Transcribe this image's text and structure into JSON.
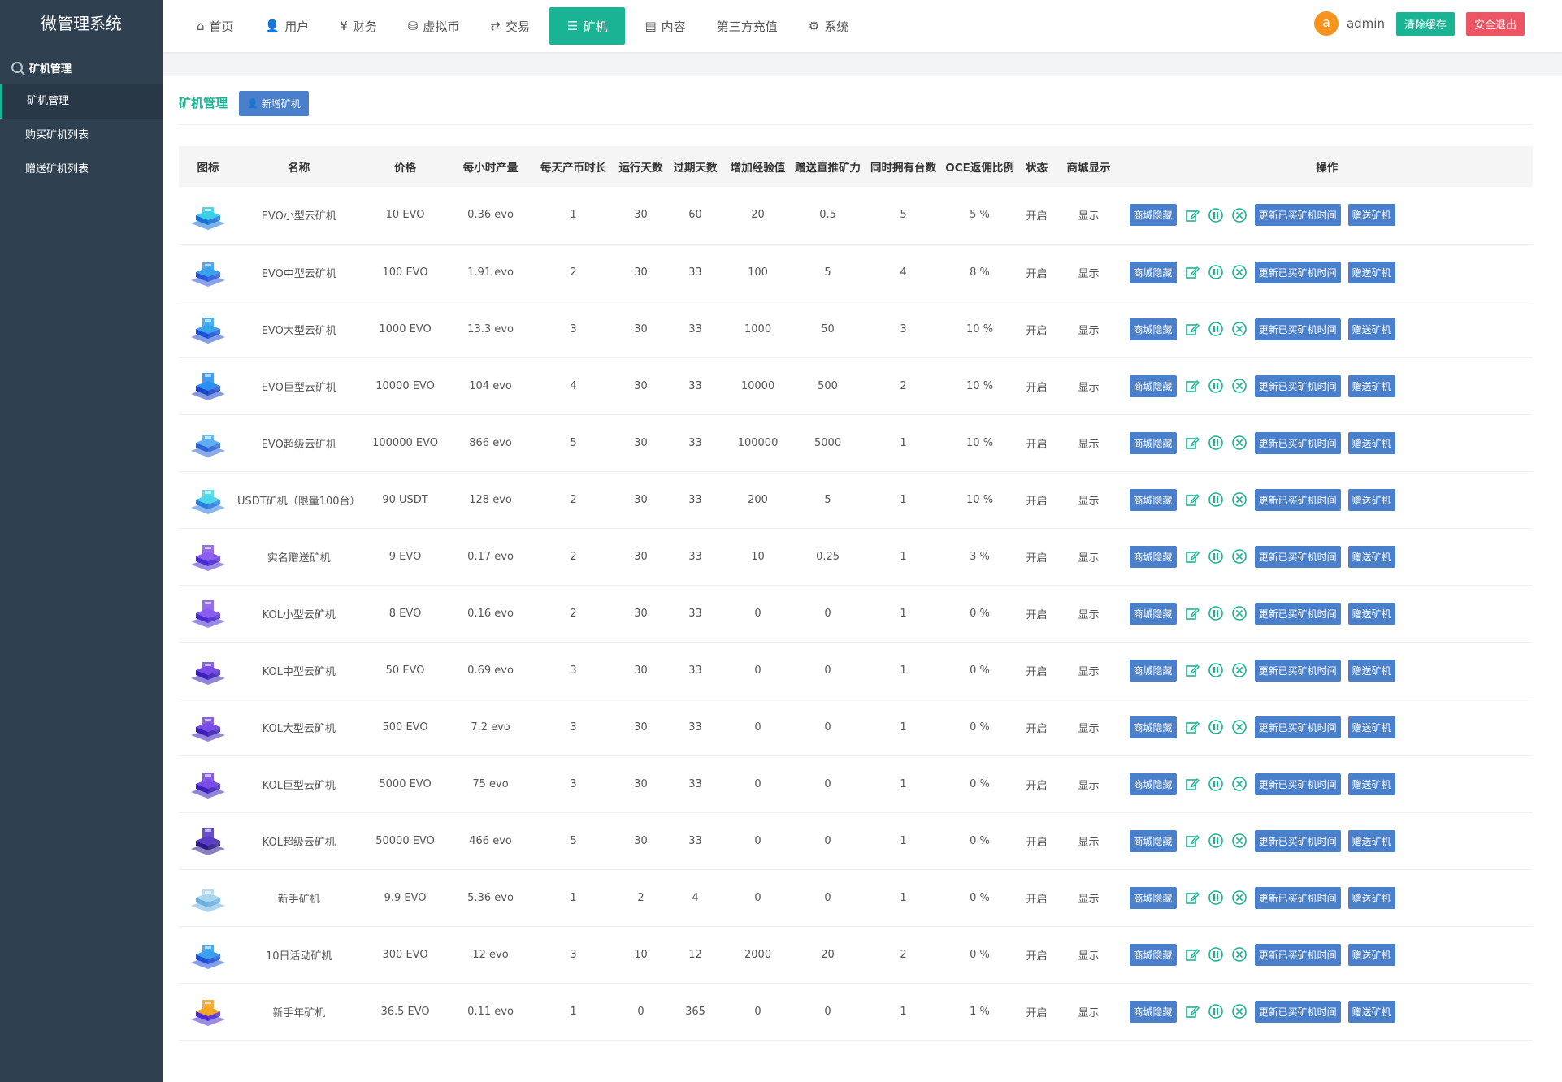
{
  "brand": "微管理系统",
  "sidebar": {
    "group": "矿机管理",
    "items": [
      {
        "label": "矿机管理",
        "active": true
      },
      {
        "label": "购买矿机列表",
        "active": false
      },
      {
        "label": "赠送矿机列表",
        "active": false
      }
    ]
  },
  "nav": [
    {
      "label": "首页",
      "icon": "home-icon",
      "glyph": "⌂"
    },
    {
      "label": "用户",
      "icon": "user-icon",
      "glyph": "👤"
    },
    {
      "label": "财务",
      "icon": "finance-icon",
      "glyph": "¥"
    },
    {
      "label": "虚拟币",
      "icon": "coin-icon",
      "glyph": "⛁"
    },
    {
      "label": "交易",
      "icon": "exchange-icon",
      "glyph": "⇄"
    },
    {
      "label": "矿机",
      "icon": "server-icon",
      "glyph": "☰"
    },
    {
      "label": "内容",
      "icon": "content-icon",
      "glyph": "▤"
    },
    {
      "label": "第三方充值",
      "icon": "",
      "glyph": ""
    },
    {
      "label": "系统",
      "icon": "gear-icon",
      "glyph": "⚙"
    }
  ],
  "user": {
    "avatar_letter": "a",
    "name": "admin"
  },
  "top_buttons": {
    "clear_cache": "清除缓存",
    "logout": "安全退出"
  },
  "panel": {
    "title": "矿机管理",
    "add_button": "新增矿机"
  },
  "colors": {
    "accent": "#1ab394",
    "blue": "#4a7fcc",
    "danger": "#ed5565",
    "sidebar": "#2f4050",
    "avatar": "#f7931e"
  },
  "table": {
    "headers": [
      "图标",
      "名称",
      "价格",
      "每小时产量",
      "每天产币时长",
      "运行天数",
      "过期天数",
      "增加经验值",
      "赠送直推矿力",
      "同时拥有台数",
      "OCE返佣比例",
      "状态",
      "商城显示",
      "操作"
    ],
    "actions": {
      "hide": "商城隐藏",
      "update_time": "更新已买矿机时间",
      "gift": "赠送矿机"
    },
    "rows": [
      {
        "icon": "evo-small-miner-icon",
        "name": "EVO小型云矿机",
        "price": "10 EVO",
        "hourly": "0.36 evo",
        "daily_hours": "1",
        "run_days": "30",
        "expire_days": "60",
        "exp": "20",
        "gift_power": "0.5",
        "max_own": "5",
        "ratio": "5 %",
        "status": "开启",
        "shop": "显示"
      },
      {
        "icon": "evo-medium-miner-icon",
        "name": "EVO中型云矿机",
        "price": "100 EVO",
        "hourly": "1.91 evo",
        "daily_hours": "2",
        "run_days": "30",
        "expire_days": "33",
        "exp": "100",
        "gift_power": "5",
        "max_own": "4",
        "ratio": "8 %",
        "status": "开启",
        "shop": "显示"
      },
      {
        "icon": "evo-large-miner-icon",
        "name": "EVO大型云矿机",
        "price": "1000 EVO",
        "hourly": "13.3 evo",
        "daily_hours": "3",
        "run_days": "30",
        "expire_days": "33",
        "exp": "1000",
        "gift_power": "50",
        "max_own": "3",
        "ratio": "10 %",
        "status": "开启",
        "shop": "显示"
      },
      {
        "icon": "evo-huge-miner-icon",
        "name": "EVO巨型云矿机",
        "price": "10000 EVO",
        "hourly": "104 evo",
        "daily_hours": "4",
        "run_days": "30",
        "expire_days": "33",
        "exp": "10000",
        "gift_power": "500",
        "max_own": "2",
        "ratio": "10 %",
        "status": "开启",
        "shop": "显示"
      },
      {
        "icon": "evo-super-miner-icon",
        "name": "EVO超级云矿机",
        "price": "100000 EVO",
        "hourly": "866 evo",
        "daily_hours": "5",
        "run_days": "30",
        "expire_days": "33",
        "exp": "100000",
        "gift_power": "5000",
        "max_own": "1",
        "ratio": "10 %",
        "status": "开启",
        "shop": "显示"
      },
      {
        "icon": "usdt-miner-icon",
        "name": "USDT矿机（限量100台）",
        "price": "90 USDT",
        "hourly": "128 evo",
        "daily_hours": "2",
        "run_days": "30",
        "expire_days": "33",
        "exp": "200",
        "gift_power": "5",
        "max_own": "1",
        "ratio": "10 %",
        "status": "开启",
        "shop": "显示"
      },
      {
        "icon": "verified-gift-miner-icon",
        "name": "实名赠送矿机",
        "price": "9 EVO",
        "hourly": "0.17 evo",
        "daily_hours": "2",
        "run_days": "30",
        "expire_days": "33",
        "exp": "10",
        "gift_power": "0.25",
        "max_own": "1",
        "ratio": "3 %",
        "status": "开启",
        "shop": "显示"
      },
      {
        "icon": "kol-small-miner-icon",
        "name": "KOL小型云矿机",
        "price": "8 EVO",
        "hourly": "0.16 evo",
        "daily_hours": "2",
        "run_days": "30",
        "expire_days": "33",
        "exp": "0",
        "gift_power": "0",
        "max_own": "1",
        "ratio": "0 %",
        "status": "开启",
        "shop": "显示"
      },
      {
        "icon": "kol-medium-miner-icon",
        "name": "KOL中型云矿机",
        "price": "50 EVO",
        "hourly": "0.69 evo",
        "daily_hours": "3",
        "run_days": "30",
        "expire_days": "33",
        "exp": "0",
        "gift_power": "0",
        "max_own": "1",
        "ratio": "0 %",
        "status": "开启",
        "shop": "显示"
      },
      {
        "icon": "kol-large-miner-icon",
        "name": "KOL大型云矿机",
        "price": "500 EVO",
        "hourly": "7.2 evo",
        "daily_hours": "3",
        "run_days": "30",
        "expire_days": "33",
        "exp": "0",
        "gift_power": "0",
        "max_own": "1",
        "ratio": "0 %",
        "status": "开启",
        "shop": "显示"
      },
      {
        "icon": "kol-huge-miner-icon",
        "name": "KOL巨型云矿机",
        "price": "5000 EVO",
        "hourly": "75 evo",
        "daily_hours": "3",
        "run_days": "30",
        "expire_days": "33",
        "exp": "0",
        "gift_power": "0",
        "max_own": "1",
        "ratio": "0 %",
        "status": "开启",
        "shop": "显示"
      },
      {
        "icon": "kol-super-miner-icon",
        "name": "KOL超级云矿机",
        "price": "50000 EVO",
        "hourly": "466 evo",
        "daily_hours": "5",
        "run_days": "30",
        "expire_days": "33",
        "exp": "0",
        "gift_power": "0",
        "max_own": "1",
        "ratio": "0 %",
        "status": "开启",
        "shop": "显示"
      },
      {
        "icon": "newbie-miner-icon",
        "name": "新手矿机",
        "price": "9.9 EVO",
        "hourly": "5.36 evo",
        "daily_hours": "1",
        "run_days": "2",
        "expire_days": "4",
        "exp": "0",
        "gift_power": "0",
        "max_own": "1",
        "ratio": "0 %",
        "status": "开启",
        "shop": "显示"
      },
      {
        "icon": "ten-day-event-miner-icon",
        "name": "10日活动矿机",
        "price": "300 EVO",
        "hourly": "12 evo",
        "daily_hours": "3",
        "run_days": "10",
        "expire_days": "12",
        "exp": "2000",
        "gift_power": "20",
        "max_own": "2",
        "ratio": "0 %",
        "status": "开启",
        "shop": "显示"
      },
      {
        "icon": "newbie-year-miner-icon",
        "name": "新手年矿机",
        "price": "36.5 EVO",
        "hourly": "0.11 evo",
        "daily_hours": "1",
        "run_days": "0",
        "expire_days": "365",
        "exp": "0",
        "gift_power": "0",
        "max_own": "1",
        "ratio": "1 %",
        "status": "开启",
        "shop": "显示"
      }
    ]
  }
}
